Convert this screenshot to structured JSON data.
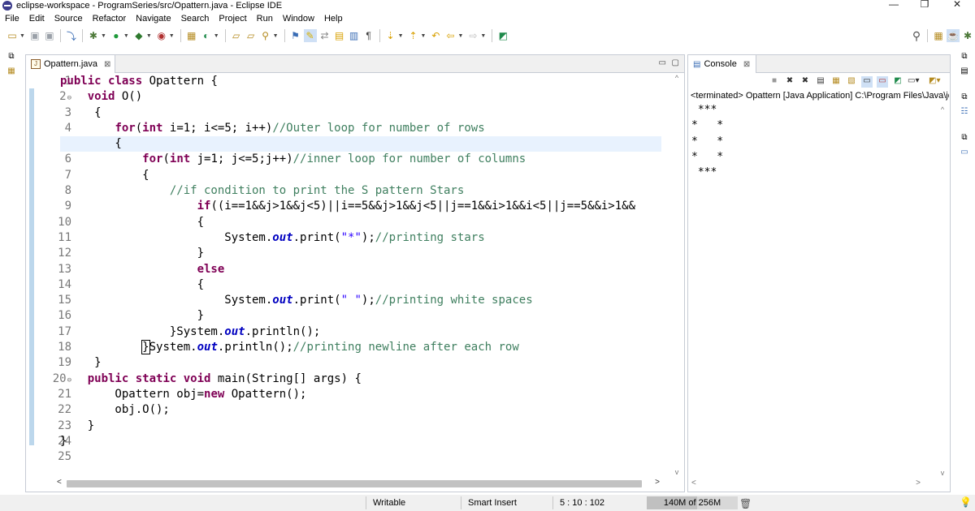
{
  "window": {
    "title": "eclipse-workspace - ProgramSeries/src/Opattern.java - Eclipse IDE",
    "minimize_icon": "—",
    "restore_icon": "❐",
    "close_icon": "✕"
  },
  "menu": [
    "File",
    "Edit",
    "Source",
    "Refactor",
    "Navigate",
    "Search",
    "Project",
    "Run",
    "Window",
    "Help"
  ],
  "editor": {
    "tab_label": "Opattern.java",
    "line_numbers": [
      "1",
      "2",
      "3",
      "4",
      "5",
      "6",
      "7",
      "8",
      "9",
      "10",
      "11",
      "12",
      "13",
      "14",
      "15",
      "16",
      "17",
      "18",
      "19",
      "20",
      "21",
      "22",
      "23",
      "24",
      "25"
    ]
  },
  "console": {
    "tab_label": "Console",
    "status": "<terminated> Opattern [Java Application] C:\\Program Files\\Java\\jdk",
    "output": [
      " ***",
      "*   *",
      "*   *",
      "*   *",
      " ***"
    ]
  },
  "statusbar": {
    "writable": "Writable",
    "insert_mode": "Smart Insert",
    "position": "5 : 10 : 102",
    "heap": "140M of 256M",
    "heap_used_fraction": 0.55
  },
  "colors": {
    "keyword": "#7f0055",
    "comment": "#3f7f5f",
    "string": "#2a00ff",
    "field": "#0000c0"
  }
}
